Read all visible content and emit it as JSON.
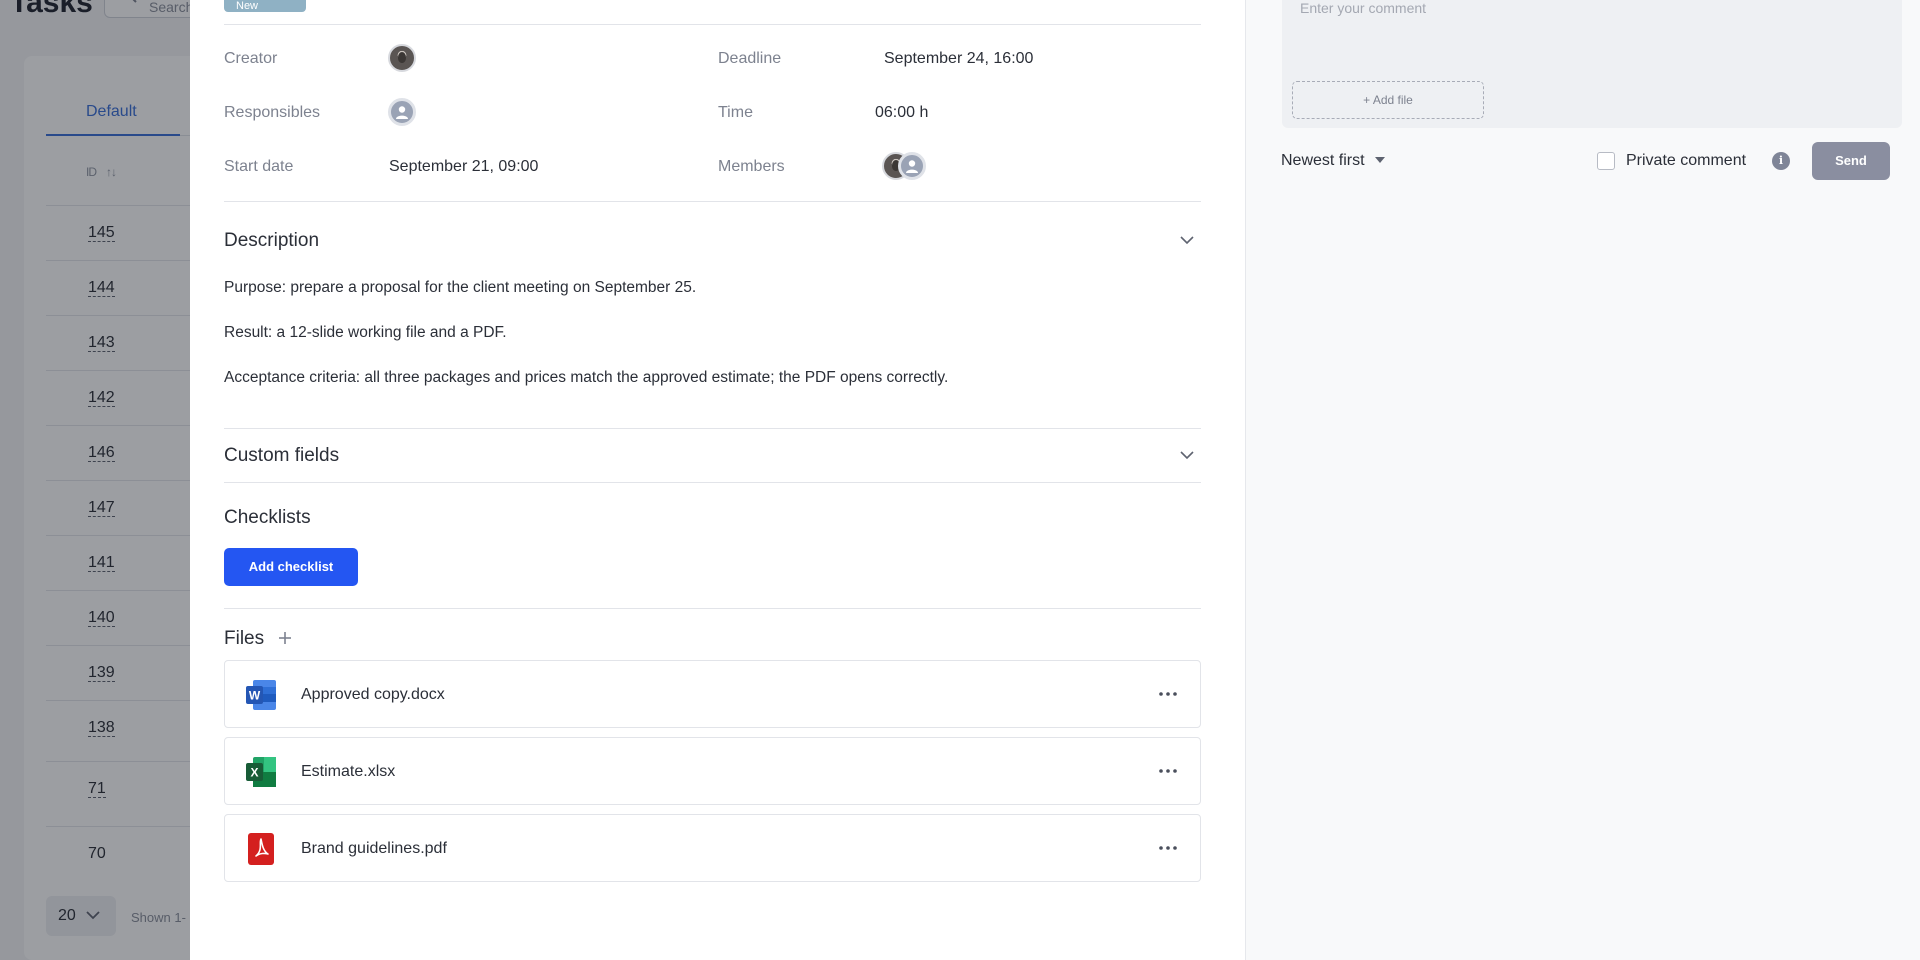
{
  "background": {
    "title": "Tasks",
    "search_placeholder": "Search",
    "tab_default": "Default",
    "column_id": "ID",
    "rows": [
      "145",
      "144",
      "143",
      "142",
      "146",
      "147",
      "141",
      "140",
      "139",
      "138",
      "71",
      "70"
    ],
    "page_size": "20",
    "shown_text": "Shown 1-"
  },
  "task": {
    "status": "New",
    "fields": {
      "creator_label": "Creator",
      "responsibles_label": "Responsibles",
      "start_label": "Start date",
      "start_value": "September 21, 09:00",
      "deadline_label": "Deadline",
      "deadline_value": "September 24, 16:00",
      "time_label": "Time",
      "time_value": "06:00 h",
      "members_label": "Members"
    },
    "description": {
      "title": "Description",
      "lines": [
        "Purpose: prepare a proposal for the client meeting on September 25.",
        "Result: a 12-slide working file and a PDF.",
        "Acceptance criteria: all three packages and prices match the approved estimate; the PDF opens correctly."
      ]
    },
    "custom_fields_title": "Custom fields",
    "checklists_title": "Checklists",
    "add_checklist_label": "Add checklist",
    "files_title": "Files",
    "files": [
      {
        "name": "Approved copy.docx",
        "icon": "word-icon",
        "color": "#2b5eb8"
      },
      {
        "name": "Estimate.xlsx",
        "icon": "excel-icon",
        "color": "#1e7a44"
      },
      {
        "name": "Brand guidelines.pdf",
        "icon": "pdf-icon",
        "color": "#d4201f"
      }
    ]
  },
  "comments": {
    "placeholder": "Enter your comment",
    "add_file_label": "+ Add file",
    "sort_label": "Newest first",
    "private_label": "Private comment",
    "send_label": "Send"
  },
  "colors": {
    "accent": "#2456f2",
    "status_chip": "#8fb1c4",
    "send_disabled": "#8a8ea0"
  }
}
